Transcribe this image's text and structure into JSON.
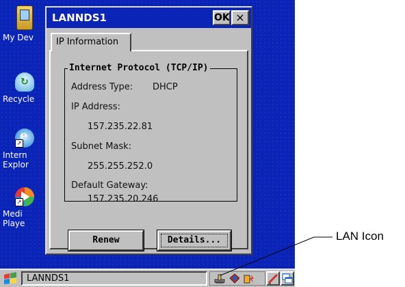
{
  "desktop": {
    "icons": [
      {
        "label": "My Dev",
        "icon": "my-device-icon"
      },
      {
        "label": "Recycle",
        "icon": "recycle-bin-icon"
      },
      {
        "label": "Intern\nExplor",
        "icon": "internet-explorer-icon"
      },
      {
        "label": "Medi\nPlaye",
        "icon": "media-player-icon"
      }
    ]
  },
  "window": {
    "title": "LANNDS1",
    "ok_label": "OK",
    "close_label": "×",
    "tab_label": "IP Information",
    "group_title": "Internet Protocol (TCP/IP)",
    "address_type_label": "Address Type:",
    "address_type_value": "DHCP",
    "ip_label": "IP Address:",
    "ip_value": "157.235.22.81",
    "subnet_label": "Subnet Mask:",
    "subnet_value": "255.255.252.0",
    "gateway_label": "Default Gateway:",
    "gateway_value": "157.235.20.246",
    "renew_label": "Renew",
    "details_label": "Details..."
  },
  "taskbar": {
    "task_label": "LANNDS1",
    "tray_icons": [
      "lan-icon",
      "security-icon",
      "battery-icon"
    ]
  },
  "callout": {
    "label": "LAN Icon"
  }
}
